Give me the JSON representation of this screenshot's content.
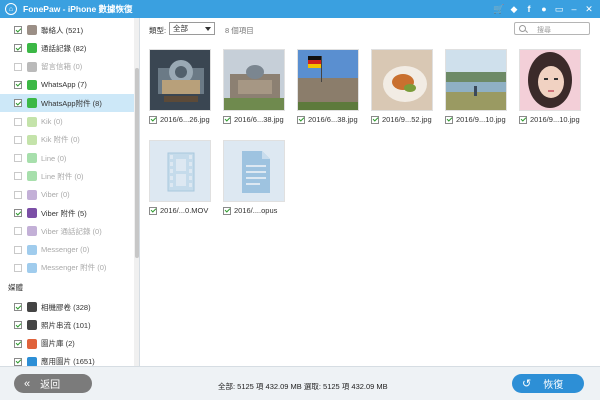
{
  "window": {
    "title": "FonePaw - iPhone 數據恢復"
  },
  "titlebar_icons": [
    "cart-icon",
    "diamond-icon",
    "facebook-icon",
    "feedback-icon",
    "menu-icon",
    "minimize-icon",
    "close-icon"
  ],
  "sidebar": {
    "items": [
      {
        "label": "聯絡人 (521)",
        "checked": true,
        "dim": false,
        "icon": "contacts-icon",
        "color": "#9b8f86"
      },
      {
        "label": "通話記錄 (82)",
        "checked": true,
        "dim": false,
        "icon": "phone-icon",
        "color": "#3cb846"
      },
      {
        "label": "留言信箱 (0)",
        "checked": false,
        "dim": true,
        "icon": "voicemail-icon",
        "color": "#666666"
      },
      {
        "label": "WhatsApp (7)",
        "checked": true,
        "dim": false,
        "icon": "whatsapp-icon",
        "color": "#3cb846"
      },
      {
        "label": "WhatsApp附件 (8)",
        "checked": true,
        "dim": false,
        "icon": "whatsapp-attachment-icon",
        "color": "#3cb846",
        "selected": true
      },
      {
        "label": "Kik (0)",
        "checked": false,
        "dim": true,
        "icon": "kik-icon",
        "color": "#7cc242"
      },
      {
        "label": "Kik 附件 (0)",
        "checked": false,
        "dim": true,
        "icon": "kik-attachment-icon",
        "color": "#7cc242"
      },
      {
        "label": "Line (0)",
        "checked": false,
        "dim": true,
        "icon": "line-icon",
        "color": "#3cb846"
      },
      {
        "label": "Line 附件 (0)",
        "checked": false,
        "dim": true,
        "icon": "line-attachment-icon",
        "color": "#3cb846"
      },
      {
        "label": "Viber (0)",
        "checked": false,
        "dim": true,
        "icon": "viber-icon",
        "color": "#7b4fa6"
      },
      {
        "label": "Viber 附件 (5)",
        "checked": true,
        "dim": false,
        "icon": "viber-attachment-icon",
        "color": "#7b4fa6"
      },
      {
        "label": "Viber 通話記錄 (0)",
        "checked": false,
        "dim": true,
        "icon": "viber-call-icon",
        "color": "#7b4fa6"
      },
      {
        "label": "Messenger (0)",
        "checked": false,
        "dim": true,
        "icon": "messenger-icon",
        "color": "#2d8fd6"
      },
      {
        "label": "Messenger 附件 (0)",
        "checked": false,
        "dim": true,
        "icon": "messenger-attachment-icon",
        "color": "#2d8fd6"
      }
    ],
    "section_media": "媒體",
    "media_items": [
      {
        "label": "相機膠卷 (328)",
        "checked": true,
        "icon": "camera-roll-icon",
        "color": "#444444"
      },
      {
        "label": "照片串流 (101)",
        "checked": true,
        "icon": "photo-stream-icon",
        "color": "#444444"
      },
      {
        "label": "圖片庫 (2)",
        "checked": true,
        "icon": "photo-library-icon",
        "color": "#e0623b"
      },
      {
        "label": "應用圖片 (1651)",
        "checked": true,
        "icon": "app-photos-icon",
        "color": "#2d8fd6"
      }
    ]
  },
  "toolbar": {
    "type_label": "類型:",
    "type_value": "全部",
    "count": "8 個項目",
    "search_placeholder": "搜尋"
  },
  "files": [
    {
      "name": "2016/6...26.jpg",
      "kind": "image",
      "thumb": "music-box"
    },
    {
      "name": "2016/6...38.jpg",
      "kind": "image",
      "thumb": "reichstag"
    },
    {
      "name": "2016/6...38.jpg",
      "kind": "image",
      "thumb": "reichstag-flag"
    },
    {
      "name": "2016/9...52.jpg",
      "kind": "image",
      "thumb": "plate"
    },
    {
      "name": "2016/9...10.jpg",
      "kind": "image",
      "thumb": "lake"
    },
    {
      "name": "2016/9...10.jpg",
      "kind": "image",
      "thumb": "portrait"
    },
    {
      "name": "2016/...0.MOV",
      "kind": "video",
      "thumb": "video-file-icon"
    },
    {
      "name": "2016/....opus",
      "kind": "document",
      "thumb": "document-file-icon"
    }
  ],
  "footer": {
    "back_label": "返回",
    "status": "全部: 5125 項 432.09 MB 選取: 5125 項 432.09 MB",
    "recover_label": "恢復"
  }
}
